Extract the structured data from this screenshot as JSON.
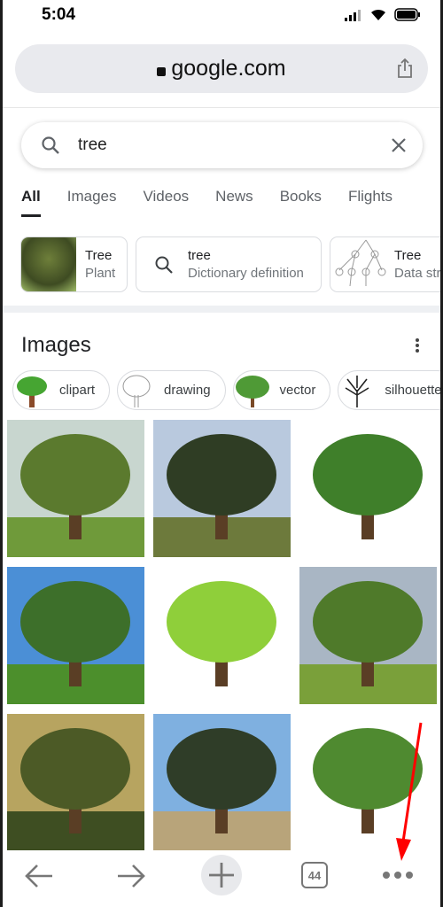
{
  "status": {
    "time": "5:04"
  },
  "browser": {
    "url": "google.com",
    "tab_count": "44"
  },
  "search": {
    "query": "tree"
  },
  "tabs": [
    "All",
    "Images",
    "Videos",
    "News",
    "Books",
    "Flights"
  ],
  "cards": [
    {
      "title": "Tree",
      "subtitle": "Plant"
    },
    {
      "title": "tree",
      "subtitle": "Dictionary definition"
    },
    {
      "title": "Tree",
      "subtitle": "Data stru"
    }
  ],
  "images": {
    "heading": "Images",
    "chips": [
      "clipart",
      "drawing",
      "vector",
      "silhouette"
    ],
    "thumbs": [
      {
        "sky": "#c8d6cf",
        "ground": "#6f9a3a",
        "crown": "#5b7a2e"
      },
      {
        "sky": "#b9c9de",
        "ground": "#6d7a3c",
        "crown": "#2f3d24"
      },
      {
        "sky": "#ffffff",
        "ground": "#ffffff",
        "crown": "#3f7f2a"
      },
      {
        "sky": "#4b8fd6",
        "ground": "#4c8f2c",
        "crown": "#3d6f2a"
      },
      {
        "sky": "#ffffff",
        "ground": "#ffffff",
        "crown": "#8fcf3a"
      },
      {
        "sky": "#a9b6c4",
        "ground": "#7aa03a",
        "crown": "#4f7a2a"
      },
      {
        "sky": "#b7a460",
        "ground": "#3e4e22",
        "crown": "#4c5a26"
      },
      {
        "sky": "#7fb0e0",
        "ground": "#b8a47a",
        "crown": "#2f3d28"
      },
      {
        "sky": "#ffffff",
        "ground": "#ffffff",
        "crown": "#4f8a30"
      }
    ]
  },
  "colors": {
    "annotation_arrow": "#ff0000"
  }
}
